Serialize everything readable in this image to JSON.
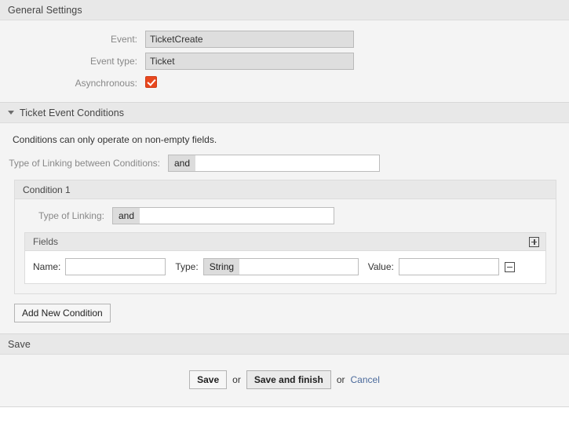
{
  "general": {
    "title": "General Settings",
    "rows": [
      {
        "label": "Event:",
        "value": "TicketCreate"
      },
      {
        "label": "Event type:",
        "value": "Ticket"
      }
    ],
    "async": {
      "label": "Asynchronous:",
      "checked": true,
      "icon": "checkbox-checked-icon"
    },
    "checkbox_color": "#e8471e"
  },
  "conditions": {
    "title": "Ticket Event Conditions",
    "toggle_icon": "triangle-down-icon",
    "note": "Conditions can only operate on non-empty fields.",
    "linking": {
      "label": "Type of Linking between Conditions:",
      "selected": "and"
    },
    "condition": {
      "title": "Condition 1",
      "linking": {
        "label": "Type of Linking:",
        "selected": "and"
      },
      "fields": {
        "title": "Fields",
        "add_icon": "plus-box-icon",
        "remove_icon": "minus-box-icon",
        "row": {
          "name_label": "Name:",
          "name_value": "",
          "name_placeholder": "",
          "type_label": "Type:",
          "type_selected": "String",
          "value_label": "Value:",
          "value_value": "",
          "value_placeholder": ""
        }
      }
    },
    "add_condition_label": "Add New Condition"
  },
  "save": {
    "title": "Save",
    "primary_label": "Save",
    "secondary_label": "Save and finish",
    "or_1": "or",
    "or_2": "or",
    "cancel_label": "Cancel",
    "cancel_color": "#4b6a9b"
  }
}
